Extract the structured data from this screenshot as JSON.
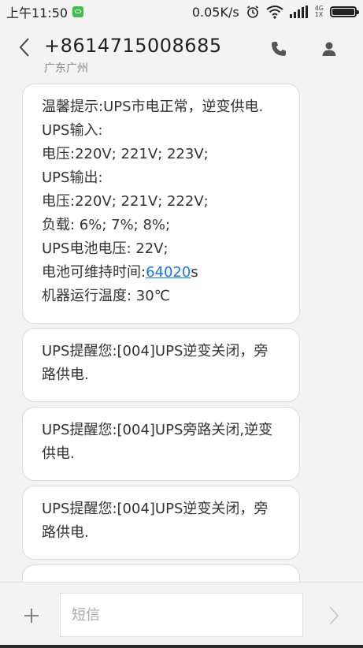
{
  "status_bar": {
    "time": "上午11:50",
    "net_speed": "0.05K/s",
    "signal_top": "4G",
    "signal_bottom": "1X"
  },
  "header": {
    "phone": "+8614715008685",
    "location": "广东广州"
  },
  "messages": [
    {
      "lines": [
        "温馨提示:UPS市电正常，逆变供电.",
        "UPS输入:",
        "电压:220V; 221V; 223V;",
        "UPS输出:",
        "电压:220V; 221V; 222V;",
        "负载: 6%;  7%;  8%;",
        "UPS电池电压: 22V;"
      ],
      "battery_prefix": "电池可维持时间:",
      "battery_link": "64020",
      "battery_suffix": "s",
      "temp_line": "机器运行温度: 30℃"
    },
    {
      "text": "UPS提醒您:[004]UPS逆变关闭，旁路供电."
    },
    {
      "text": "UPS提醒您:[004]UPS旁路关闭,逆变供电."
    },
    {
      "text": "UPS提醒您:[004]UPS逆变关闭，旁路供电."
    }
  ],
  "input": {
    "placeholder": "短信",
    "value": ""
  },
  "colors": {
    "link": "#1a73e8",
    "wechat_badge": "#3fbf4a"
  }
}
